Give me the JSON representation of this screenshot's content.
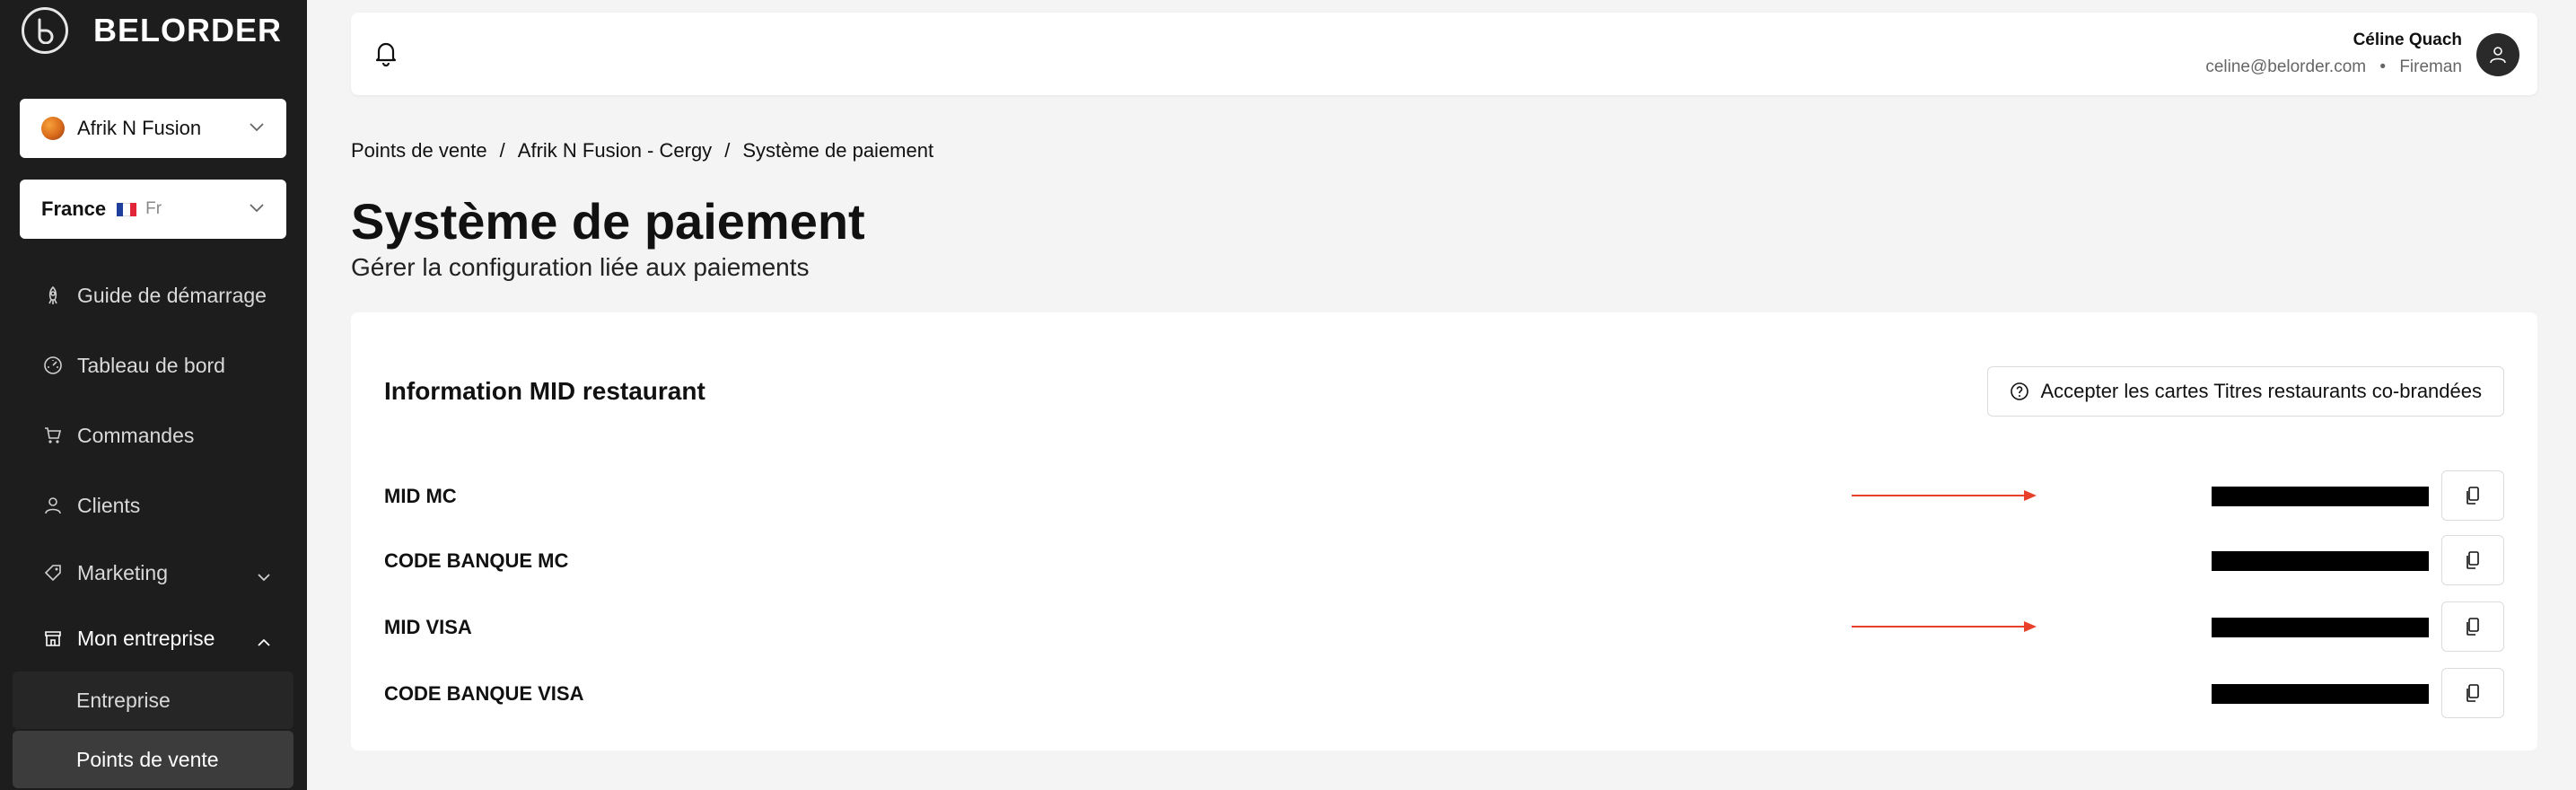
{
  "brand": {
    "name": "BELORDER"
  },
  "restaurant_select": {
    "value": "Afrik N Fusion"
  },
  "country_select": {
    "country": "France",
    "lang": "Fr"
  },
  "sidebar": {
    "items": [
      {
        "label": "Guide de démarrage",
        "icon": "rocket-icon"
      },
      {
        "label": "Tableau de bord",
        "icon": "dashboard-icon"
      },
      {
        "label": "Commandes",
        "icon": "cart-icon"
      },
      {
        "label": "Clients",
        "icon": "user-icon"
      },
      {
        "label": "Marketing",
        "icon": "tag-icon"
      },
      {
        "label": "Mon entreprise",
        "icon": "store-icon"
      }
    ],
    "subitems": [
      {
        "label": "Entreprise"
      },
      {
        "label": "Points de vente",
        "active": true
      }
    ]
  },
  "header": {
    "user_name": "Céline Quach",
    "user_email": "celine@belorder.com",
    "user_role": "Fireman",
    "separator": "•"
  },
  "breadcrumb": [
    "Points de vente",
    "Afrik N Fusion - Cergy",
    "Système de paiement"
  ],
  "page": {
    "title": "Système de paiement",
    "subtitle": "Gérer la configuration liée aux paiements"
  },
  "card": {
    "title": "Information MID restaurant",
    "accept_button": "Accepter les cartes Titres restaurants co-brandées",
    "rows": [
      {
        "label": "MID MC",
        "arrow": true
      },
      {
        "label": "CODE BANQUE MC",
        "arrow": false
      },
      {
        "label": "MID VISA",
        "arrow": true
      },
      {
        "label": "CODE BANQUE VISA",
        "arrow": false
      }
    ]
  },
  "colors": {
    "sidebar_bg": "#1d1d1d",
    "arrow": "#e8402a",
    "page_bg": "#f4f4f4",
    "flag_blue": "#1f3f9c",
    "flag_red": "#e1263a"
  }
}
